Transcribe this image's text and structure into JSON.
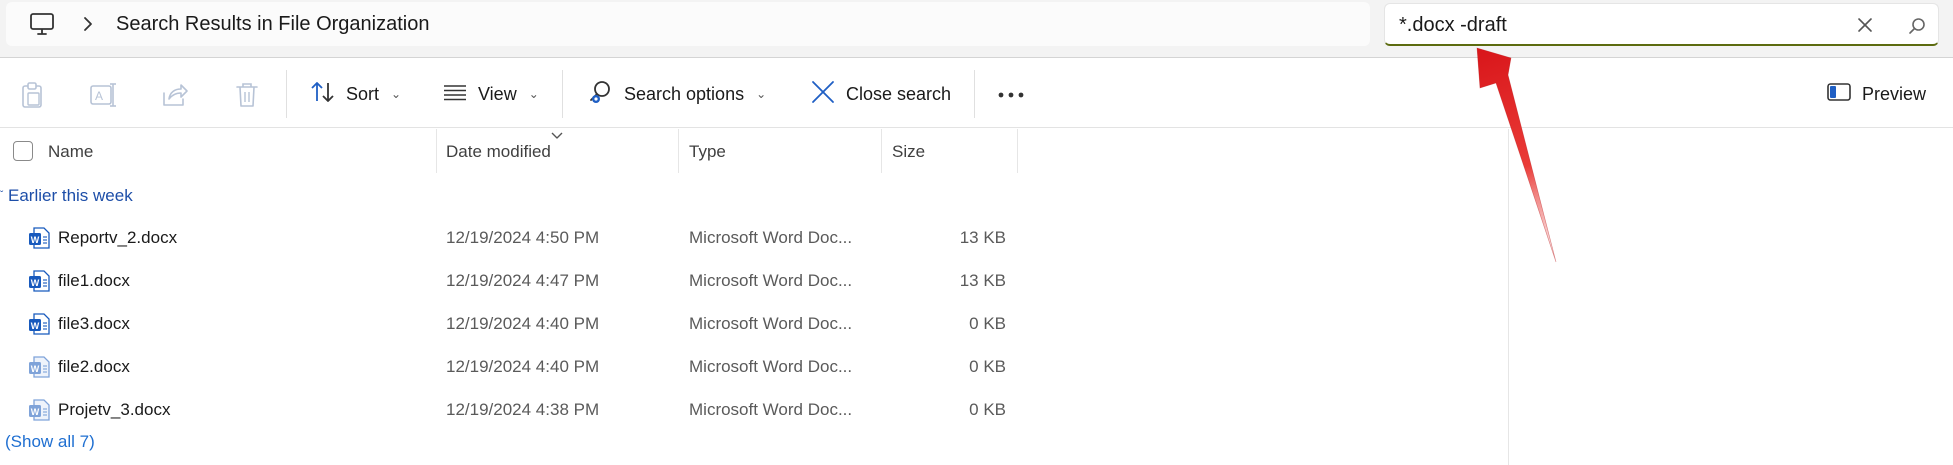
{
  "address_bar": {
    "location_icon": "this-pc-icon",
    "chevron_icon": "chevron-right-icon",
    "path_text": "Search Results in File Organization"
  },
  "search": {
    "value": "*.docx -draft",
    "clear_icon": "close-icon",
    "search_icon": "search-icon"
  },
  "command_bar": {
    "icon_buttons": [
      "paste-icon",
      "rename-icon",
      "share-icon",
      "delete-icon"
    ],
    "sort_label": "Sort",
    "view_label": "View",
    "search_options_label": "Search options",
    "close_search_label": "Close search",
    "more_icon": "more-icon",
    "preview_label": "Preview"
  },
  "columns": {
    "name": "Name",
    "date_modified": "Date modified",
    "type": "Type",
    "size": "Size",
    "sorted_by": "date_modified"
  },
  "group": {
    "label": "Earlier this week"
  },
  "files": [
    {
      "name": "Reportv_2.docx",
      "date": "12/19/2024 4:50 PM",
      "type": "Microsoft Word Doc...",
      "size": "13 KB",
      "icon": "word-doc-icon"
    },
    {
      "name": "file1.docx",
      "date": "12/19/2024 4:47 PM",
      "type": "Microsoft Word Doc...",
      "size": "13 KB",
      "icon": "word-doc-icon"
    },
    {
      "name": "file3.docx",
      "date": "12/19/2024 4:40 PM",
      "type": "Microsoft Word Doc...",
      "size": "0 KB",
      "icon": "word-doc-icon"
    },
    {
      "name": "file2.docx",
      "date": "12/19/2024 4:40 PM",
      "type": "Microsoft Word Doc...",
      "size": "0 KB",
      "icon": "word-doc-icon-light"
    },
    {
      "name": "Projetv_3.docx",
      "date": "12/19/2024 4:38 PM",
      "type": "Microsoft Word Doc...",
      "size": "0 KB",
      "icon": "word-doc-icon-light"
    }
  ],
  "show_all": "(Show all 7)",
  "colors": {
    "accent": "#1d4ea8",
    "link": "#1f6fd1",
    "search_underline": "#5c6b0f",
    "annotation_arrow": "#e0201d",
    "word_blue": "#185abd"
  }
}
